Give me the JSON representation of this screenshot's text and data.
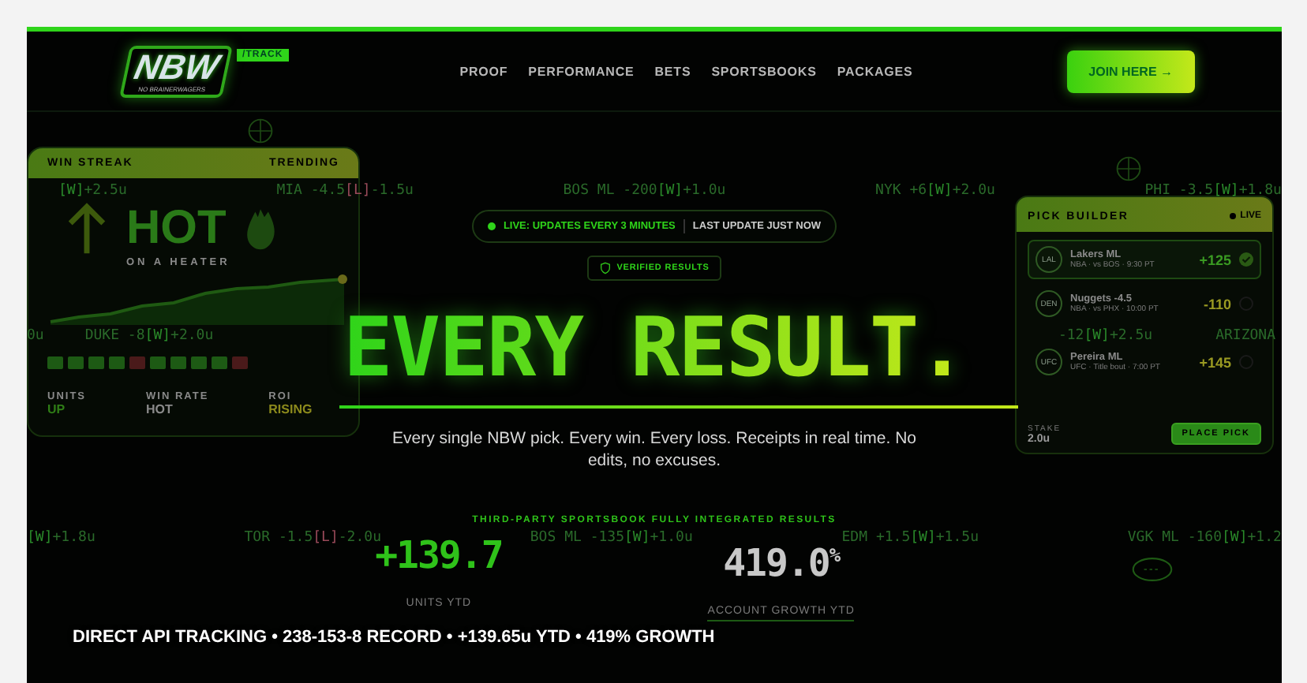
{
  "nav": {
    "logo": "NBW",
    "tagline": "NO BRAINERWAGERS",
    "badge": "/TRACK",
    "links": [
      "PROOF",
      "PERFORMANCE",
      "BETS",
      "SPORTSBOOKS",
      "PACKAGES"
    ],
    "cta": "JOIN HERE →"
  },
  "ticker_rows": [
    {
      "groups": [
        [
          {
            "tag": "[W]",
            "color": "#2a8a2a",
            "units": "+2.5u"
          },
          {
            "pick": "MIA -4.5",
            "tag": "[L]",
            "color": "#9a4a5a",
            "units": "-1.5u"
          },
          {
            "pick": "BOS ML -200",
            "tag": "[W]",
            "color": "#2a8a2a",
            "units": "+1.0u"
          },
          {
            "pick": "NYK +6",
            "tag": "[W]",
            "color": "#2a8a2a",
            "units": "+2.0u"
          },
          {
            "pick": "PHI -3.5",
            "tag": "[W]",
            "color": "#2a8a2a",
            "units": "+1.8u"
          }
        ]
      ]
    },
    {
      "groups": [
        [
          {
            "units": "0u"
          },
          {
            "pick": "DUKE -8",
            "tag": "[W]",
            "color": "#2a8a2a",
            "units": "+2.0u"
          }
        ],
        [
          {
            "pick": "-12",
            "tag": "[W]",
            "color": "#2a8a2a",
            "units": "+2.5u"
          },
          {
            "pick": "ARIZONA"
          }
        ]
      ]
    },
    {
      "groups": [
        [
          {
            "tag": "[W]",
            "color": "#2a8a2a",
            "units": "+1.8u"
          },
          {
            "pick": "TOR -1.5",
            "tag": "[L]",
            "color": "#9a4a5a",
            "units": "-2.0u"
          },
          {
            "pick": "BOS ML -135",
            "tag": "[W]",
            "color": "#2a8a2a",
            "units": "+1.0u"
          },
          {
            "pick": "EDM +1.5",
            "tag": "[W]",
            "color": "#2a8a2a",
            "units": "+1.5u"
          },
          {
            "pick": "VGK ML -160",
            "tag": "[W]",
            "color": "#2a8a2a",
            "units": "+1.2"
          }
        ]
      ]
    }
  ],
  "streak_card": {
    "labels": [
      "WIN STREAK",
      "TRENDING"
    ],
    "status": "HOT",
    "caption": "ON A HEATER",
    "results": [
      {
        "color": "#1d5a14"
      },
      {
        "color": "#1d5a14"
      },
      {
        "color": "#1d5a14"
      },
      {
        "color": "#1d5a14"
      },
      {
        "color": "#4a1a1a"
      },
      {
        "color": "#1d5a14"
      },
      {
        "color": "#1d5a14"
      },
      {
        "color": "#1d5a14"
      },
      {
        "color": "#1d5a14"
      },
      {
        "color": "#4a1a1a"
      }
    ],
    "stats": [
      {
        "label": "UNITS",
        "value": "UP",
        "color": "#2f7d16"
      },
      {
        "label": "WIN RATE",
        "value": "HOT",
        "color": "#8a8a8a"
      },
      {
        "label": "ROI",
        "value": "RISING",
        "color": "#8c8a1c"
      }
    ]
  },
  "pick_builder": {
    "title": "PICK BUILDER",
    "live": "LIVE",
    "picks": [
      {
        "badge": "LAL",
        "name": "Lakers ML",
        "meta": "NBA · vs BOS · 9:30 PT",
        "odds": "+125",
        "selected": true
      },
      {
        "badge": "DEN",
        "name": "Nuggets -4.5",
        "meta": "NBA · vs PHX · 10:00 PT",
        "odds": "-110",
        "selected": false
      },
      {
        "badge": "UFC",
        "name": "Pereira ML",
        "meta": "UFC · Title bout · 7:00 PT",
        "odds": "+145",
        "selected": false
      }
    ],
    "stake_label": "STAKE",
    "stake": "2.0u",
    "button": "PLACE PICK"
  },
  "live_pill": {
    "status": "LIVE: UPDATES EVERY 3 MINUTES",
    "updated": "LAST UPDATE JUST NOW"
  },
  "verified": "VERIFIED RESULTS",
  "headline": "EVERY RESULT.",
  "subtitle": "Every single NBW pick. Every win. Every loss. Receipts in real time. No edits, no excuses.",
  "integration_label": "THIRD-PARTY SPORTSBOOK FULLY INTEGRATED RESULTS",
  "stats": [
    {
      "kind": "units",
      "value": "+139.7",
      "label": "UNITS YTD"
    },
    {
      "kind": "growth",
      "value": "419.0",
      "suffix": "%",
      "label": "ACCOUNT GROWTH YTD"
    }
  ],
  "caption": "DIRECT API TRACKING • 238-153-8 RECORD • +139.65u YTD • 419% GROWTH"
}
